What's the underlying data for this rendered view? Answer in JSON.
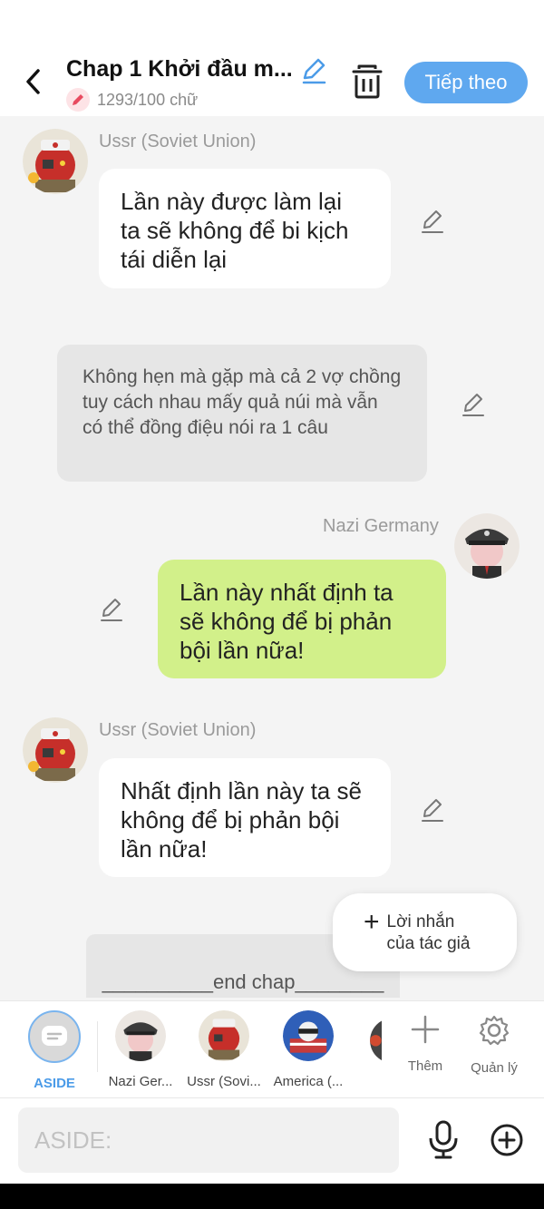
{
  "header": {
    "title": "Chap 1 Khởi đầu m...",
    "word_count": "1293/100 chữ",
    "next_label": "Tiếp theo",
    "accent_color": "#5fa8ef"
  },
  "messages": [
    {
      "type": "left",
      "sender": "Ussr (Soviet Union)",
      "text": "Lần này được làm lại\nta sẽ không để bi kịch\ntái diễn lại"
    },
    {
      "type": "narration",
      "text": "Không hẹn mà gặp mà cả 2 vợ chồng tuy cách nhau mấy quả núi mà vẫn có thể đồng điệu nói ra 1 câu"
    },
    {
      "type": "right",
      "sender": "Nazi Germany",
      "text": "Lần này nhất định ta\nsẽ không để bị phản\nbội lần nữa!"
    },
    {
      "type": "left",
      "sender": "Ussr (Soviet Union)",
      "text": "Nhất định lần này ta sẽ\nkhông để bị phản bội\nlần nữa!"
    }
  ],
  "end_chap": "__________end chap________",
  "author_note": {
    "plus": "+",
    "label": "Lời nhắn\ncủa tác giả"
  },
  "characters": [
    {
      "name": "ASIDE",
      "active": true
    },
    {
      "name": "Nazi Ger..."
    },
    {
      "name": "Ussr (Sovi..."
    },
    {
      "name": "America (..."
    }
  ],
  "tools": {
    "add_label": "Thêm",
    "manage_label": "Quản lý"
  },
  "input": {
    "placeholder": "ASIDE:"
  },
  "colors": {
    "bubble_right": "#d2f08a",
    "chat_bg": "#f4f4f4",
    "aside_label": "#4b9be8"
  }
}
